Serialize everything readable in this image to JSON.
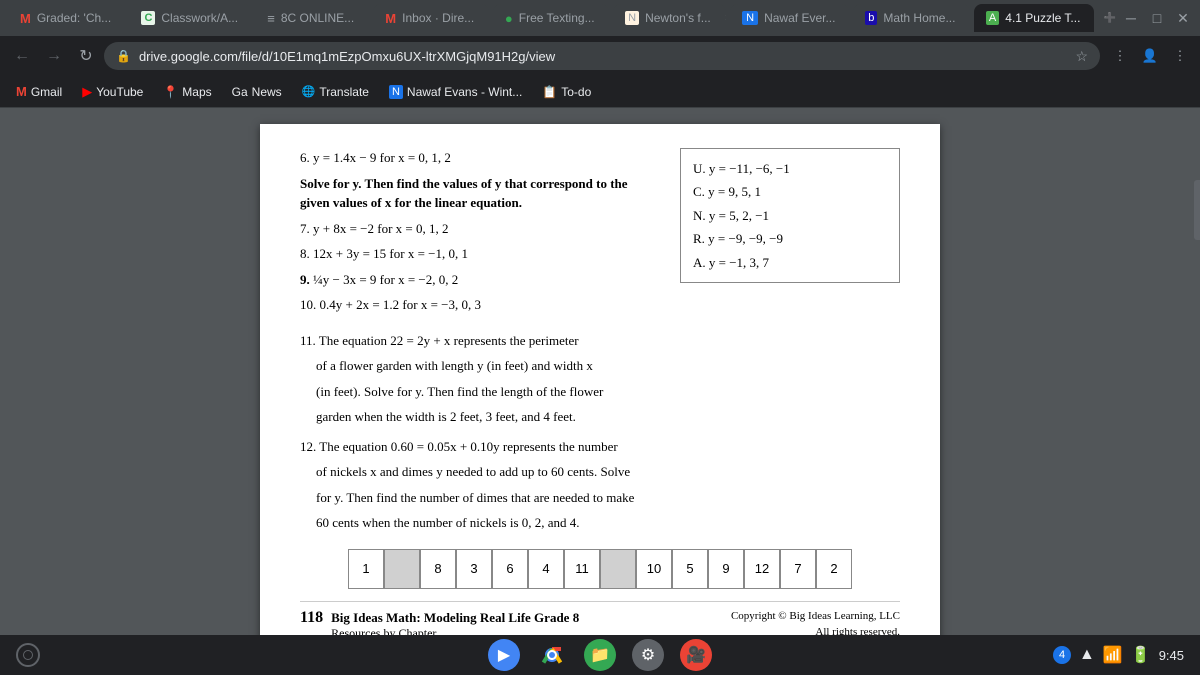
{
  "tabs": [
    {
      "id": "graded",
      "label": "Graded: 'Ch...",
      "active": false,
      "icon": "M"
    },
    {
      "id": "classwork",
      "label": "Classwork/A...",
      "active": false,
      "icon": "C"
    },
    {
      "id": "8c-online",
      "label": "8C ONLINE...",
      "active": false,
      "icon": "≡"
    },
    {
      "id": "inbox",
      "label": "Inbox · Dire...",
      "active": false,
      "icon": "M"
    },
    {
      "id": "free-texting",
      "label": "Free Texting...",
      "active": false,
      "icon": "●"
    },
    {
      "id": "newtons",
      "label": "Newton's f...",
      "active": false,
      "icon": "N"
    },
    {
      "id": "nawaf-ever",
      "label": "Nawaf Ever...",
      "active": false,
      "icon": "N"
    },
    {
      "id": "math-home",
      "label": "Math Home...",
      "active": false,
      "icon": "b"
    },
    {
      "id": "puzzle",
      "label": "4.1 Puzzle T...",
      "active": true,
      "icon": "A"
    }
  ],
  "address": "drive.google.com/file/d/10E1mq1mEzpOmxu6UX-ltrXMGjqM91H2g/view",
  "bookmarks": [
    {
      "id": "gmail",
      "label": "Gmail",
      "icon": "M"
    },
    {
      "id": "youtube",
      "label": "YouTube",
      "icon": "▶"
    },
    {
      "id": "maps",
      "label": "Maps",
      "icon": "📍"
    },
    {
      "id": "news",
      "label": "News",
      "icon": "G"
    },
    {
      "id": "translate",
      "label": "Translate",
      "icon": "T"
    },
    {
      "id": "nawaf-evans",
      "label": "Nawaf Evans - Wint...",
      "icon": "N"
    },
    {
      "id": "todo",
      "label": "To-do",
      "icon": "📋"
    }
  ],
  "pdf": {
    "problem6": "6.  y = 1.4x − 9 for x = 0, 1, 2",
    "section_header_line1": "Solve for y. Then find the values of y that correspond to the",
    "section_header_line2": "given values of x for the linear equation.",
    "problem7": "7.  y + 8x = −2 for x = 0, 1, 2",
    "problem8": "8.  12x + 3y = 15 for x = −1, 0, 1",
    "problem9": "9.  ¼y − 3x = 9 for x = −2, 0, 2",
    "problem10": "10.  0.4y + 2x = 1.2 for x = −3, 0, 3",
    "problem11_intro": "11.  The equation 22 = 2y + x represents the perimeter",
    "problem11_line2": "of a flower garden with length y (in feet) and width x",
    "problem11_line3": "(in feet). Solve for y. Then find the length of the flower",
    "problem11_line4": "garden when the width is 2 feet, 3 feet, and 4 feet.",
    "problem12_intro": "12.  The equation 0.60 = 0.05x + 0.10y represents the number",
    "problem12_line2": "of nickels x and dimes y needed to add up to 60 cents. Solve",
    "problem12_line3": "for y. Then find the number of dimes that are needed to make",
    "problem12_line4": "60 cents when the number of nickels is 0, 2, and 4.",
    "answers": {
      "U": "U.  y = −11, −6, −1",
      "C": "C.  y = 9, 5, 1",
      "N": "N.  y = 5, 2, −1",
      "R": "R.  y = −9, −9, −9",
      "A": "A.  y = −1, 3, 7"
    },
    "grid_numbers": [
      "1",
      "",
      "8",
      "3",
      "6",
      "4",
      "11",
      "",
      "10",
      "5",
      "9",
      "12",
      "7",
      "2"
    ],
    "page_number": "118",
    "footer_title": "Big Ideas Math: Modeling Real Life Grade 8",
    "footer_sub": "Resources by Chapter",
    "copyright": "Copyright © Big Ideas Learning, LLC",
    "rights": "All rights reserved."
  },
  "taskbar": {
    "badge_count": "4",
    "time": "9:45"
  }
}
